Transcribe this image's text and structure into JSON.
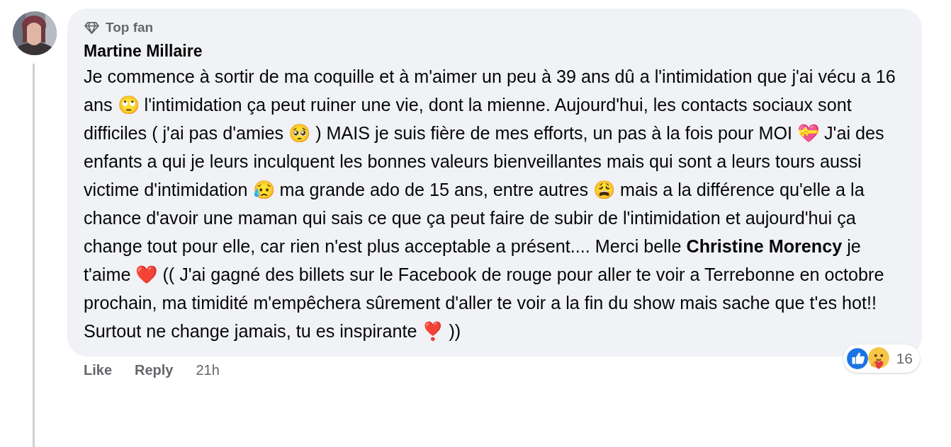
{
  "comment": {
    "badge": "Top fan",
    "author": "Martine Millaire",
    "text": "Je commence à sortir de ma coquille et à m'aimer un peu à 39 ans dû a l'intimidation que j'ai vécu a 16 ans 🙄 l'intimidation ça peut ruiner une vie, dont la mienne. Aujourd'hui, les contacts sociaux sont difficiles ( j'ai pas d'amies 🥺 ) MAIS je suis fière de mes efforts, un pas à la fois pour MOI 💝 J'ai des enfants a qui je leurs inculquent les bonnes valeurs bienveillantes mais qui sont a leurs tours aussi victime d'intimidation 😥 ma grande ado de 15 ans, entre autres 😩 mais a la différence qu'elle a la chance d'avoir une maman qui sais ce que ça peut faire de subir de l'intimidation et aujourd'hui ça change tout pour elle, car rien n'est plus acceptable a présent.... Merci belle **Christine Morency** je t'aime ❤️ (( J'ai gagné des billets sur le Facebook de rouge pour aller te voir a Terrebonne en octobre prochain, ma timidité m'empêchera sûrement d'aller te voir a la fin du show mais sache que t'es hot!! Surtout ne change jamais, tu es inspirante ❣️ ))",
    "reaction_count": "16"
  },
  "actions": [
    {
      "label": "Like"
    },
    {
      "label": "Reply"
    }
  ],
  "time": "21h"
}
